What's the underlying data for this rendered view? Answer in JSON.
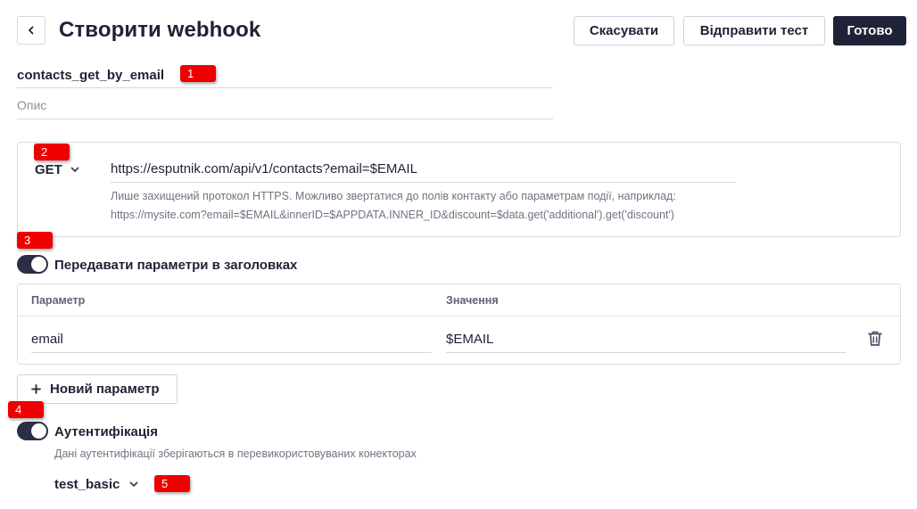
{
  "header": {
    "title": "Створити webhook",
    "cancel_label": "Скасувати",
    "send_test_label": "Відправити тест",
    "done_label": "Готово"
  },
  "form": {
    "name_value": "contacts_get_by_email",
    "description_placeholder": "Опис"
  },
  "request": {
    "method": "GET",
    "url": "https://esputnik.com/api/v1/contacts?email=$EMAIL",
    "hint_line1": "Лише захищений протокол HTTPS. Можливо звертатися до полів контакту або параметрам події, наприклад:",
    "hint_line2": "https://mysite.com?email=$EMAIL&innerID=$APPDATA.INNER_ID&discount=$data.get('additional').get('discount')"
  },
  "headers_params": {
    "toggle_label": "Передавати параметри в заголовках",
    "enabled": true,
    "col_param": "Параметр",
    "col_value": "Значення",
    "rows": [
      {
        "param": "email",
        "value": "$EMAIL"
      }
    ],
    "add_label": "Новий параметр"
  },
  "auth": {
    "toggle_label": "Аутентифікація",
    "enabled": true,
    "hint": "Дані аутентифікації зберігаються в перевикористовуваних конекторах",
    "connector": "test_basic"
  },
  "badges": [
    "1",
    "2",
    "3",
    "4",
    "5"
  ],
  "colors": {
    "primary_dark": "#1f2338",
    "badge_red": "#ee0000",
    "border": "#d9dce2"
  },
  "icons": {
    "back": "chevron-left-icon",
    "method_dropdown": "chevron-down-icon",
    "delete": "trash-icon",
    "add": "plus-icon",
    "connector_dropdown": "chevron-down-icon"
  }
}
